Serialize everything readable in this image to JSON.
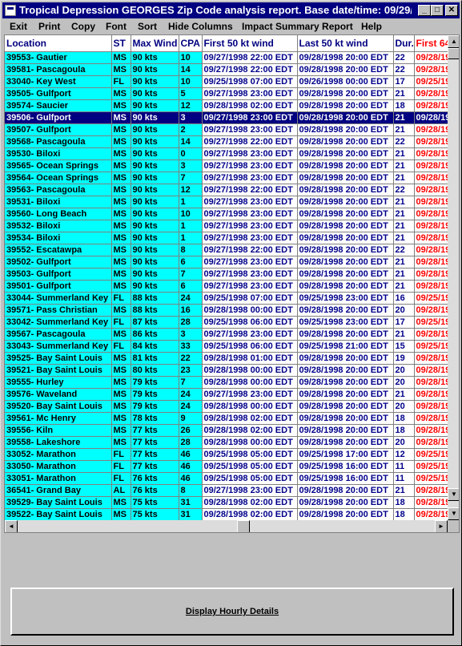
{
  "window": {
    "title": "Tropical Depression GEORGES Zip Code  analysis report.  Base date/time: 09/29/19...",
    "minimize": "_",
    "maximize": "□",
    "close": "✕"
  },
  "menu": [
    "Exit",
    "Print",
    "Copy",
    "Font",
    "Sort",
    "Hide Columns",
    "Impact Summary Report",
    "Help"
  ],
  "columns": [
    "Location",
    "ST",
    "Max Wind",
    "CPA",
    "First 50 kt wind",
    "Last 50 kt wind",
    "Dur.",
    "First 64"
  ],
  "rows": [
    [
      "39553- Gautier",
      "MS",
      "90 kts",
      "10",
      "09/27/1998 22:00 EDT",
      "09/28/1998 20:00 EDT",
      "22",
      "09/28/19"
    ],
    [
      "39581- Pascagoula",
      "MS",
      "90 kts",
      "14",
      "09/27/1998 22:00 EDT",
      "09/28/1998 20:00 EDT",
      "22",
      "09/28/19"
    ],
    [
      "33040- Key West",
      "FL",
      "90 kts",
      "10",
      "09/25/1998 07:00 EDT",
      "09/26/1998 00:00 EDT",
      "17",
      "09/25/19"
    ],
    [
      "39505- Gulfport",
      "MS",
      "90 kts",
      "5",
      "09/27/1998 23:00 EDT",
      "09/28/1998 20:00 EDT",
      "21",
      "09/28/19"
    ],
    [
      "39574- Saucier",
      "MS",
      "90 kts",
      "12",
      "09/28/1998 02:00 EDT",
      "09/28/1998 20:00 EDT",
      "18",
      "09/28/19"
    ],
    [
      "39506- Gulfport",
      "MS",
      "90 kts",
      "3",
      "09/27/1998 23:00 EDT",
      "09/28/1998 20:00 EDT",
      "21",
      "09/28/19"
    ],
    [
      "39507- Gulfport",
      "MS",
      "90 kts",
      "2",
      "09/27/1998 23:00 EDT",
      "09/28/1998 20:00 EDT",
      "21",
      "09/28/19"
    ],
    [
      "39568- Pascagoula",
      "MS",
      "90 kts",
      "14",
      "09/27/1998 22:00 EDT",
      "09/28/1998 20:00 EDT",
      "22",
      "09/28/19"
    ],
    [
      "39530- Biloxi",
      "MS",
      "90 kts",
      "0",
      "09/27/1998 23:00 EDT",
      "09/28/1998 20:00 EDT",
      "21",
      "09/28/19"
    ],
    [
      "39565- Ocean Springs",
      "MS",
      "90 kts",
      "3",
      "09/27/1998 23:00 EDT",
      "09/28/1998 20:00 EDT",
      "21",
      "09/28/19"
    ],
    [
      "39564- Ocean Springs",
      "MS",
      "90 kts",
      "7",
      "09/27/1998 23:00 EDT",
      "09/28/1998 20:00 EDT",
      "21",
      "09/28/19"
    ],
    [
      "39563- Pascagoula",
      "MS",
      "90 kts",
      "12",
      "09/27/1998 22:00 EDT",
      "09/28/1998 20:00 EDT",
      "22",
      "09/28/19"
    ],
    [
      "39531- Biloxi",
      "MS",
      "90 kts",
      "1",
      "09/27/1998 23:00 EDT",
      "09/28/1998 20:00 EDT",
      "21",
      "09/28/19"
    ],
    [
      "39560- Long Beach",
      "MS",
      "90 kts",
      "10",
      "09/27/1998 23:00 EDT",
      "09/28/1998 20:00 EDT",
      "21",
      "09/28/19"
    ],
    [
      "39532- Biloxi",
      "MS",
      "90 kts",
      "1",
      "09/27/1998 23:00 EDT",
      "09/28/1998 20:00 EDT",
      "21",
      "09/28/19"
    ],
    [
      "39534- Biloxi",
      "MS",
      "90 kts",
      "1",
      "09/27/1998 23:00 EDT",
      "09/28/1998 20:00 EDT",
      "21",
      "09/28/19"
    ],
    [
      "39552- Escatawpa",
      "MS",
      "90 kts",
      "8",
      "09/27/1998 22:00 EDT",
      "09/28/1998 20:00 EDT",
      "22",
      "09/28/19"
    ],
    [
      "39502- Gulfport",
      "MS",
      "90 kts",
      "6",
      "09/27/1998 23:00 EDT",
      "09/28/1998 20:00 EDT",
      "21",
      "09/28/19"
    ],
    [
      "39503- Gulfport",
      "MS",
      "90 kts",
      "7",
      "09/27/1998 23:00 EDT",
      "09/28/1998 20:00 EDT",
      "21",
      "09/28/19"
    ],
    [
      "39501- Gulfport",
      "MS",
      "90 kts",
      "6",
      "09/27/1998 23:00 EDT",
      "09/28/1998 20:00 EDT",
      "21",
      "09/28/19"
    ],
    [
      "33044- Summerland Key",
      "FL",
      "88 kts",
      "24",
      "09/25/1998 07:00 EDT",
      "09/25/1998 23:00 EDT",
      "16",
      "09/25/19"
    ],
    [
      "39571- Pass Christian",
      "MS",
      "88 kts",
      "16",
      "09/28/1998 00:00 EDT",
      "09/28/1998 20:00 EDT",
      "20",
      "09/28/19"
    ],
    [
      "33042- Summerland Key",
      "FL",
      "87 kts",
      "28",
      "09/25/1998 06:00 EDT",
      "09/25/1998 23:00 EDT",
      "17",
      "09/25/19"
    ],
    [
      "39567- Pascagoula",
      "MS",
      "86 kts",
      "3",
      "09/27/1998 23:00 EDT",
      "09/28/1998 20:00 EDT",
      "21",
      "09/28/19"
    ],
    [
      "33043- Summerland Key",
      "FL",
      "84 kts",
      "33",
      "09/25/1998 06:00 EDT",
      "09/25/1998 21:00 EDT",
      "15",
      "09/25/19"
    ],
    [
      "39525- Bay Saint Louis",
      "MS",
      "81 kts",
      "22",
      "09/28/1998 01:00 EDT",
      "09/28/1998 20:00 EDT",
      "19",
      "09/28/19"
    ],
    [
      "39521- Bay Saint Louis",
      "MS",
      "80 kts",
      "23",
      "09/28/1998 00:00 EDT",
      "09/28/1998 20:00 EDT",
      "20",
      "09/28/19"
    ],
    [
      "39555- Hurley",
      "MS",
      "79 kts",
      "7",
      "09/28/1998 00:00 EDT",
      "09/28/1998 20:00 EDT",
      "20",
      "09/28/19"
    ],
    [
      "39576- Waveland",
      "MS",
      "79 kts",
      "24",
      "09/27/1998 23:00 EDT",
      "09/28/1998 20:00 EDT",
      "21",
      "09/28/19"
    ],
    [
      "39520- Bay Saint Louis",
      "MS",
      "79 kts",
      "24",
      "09/28/1998 00:00 EDT",
      "09/28/1998 20:00 EDT",
      "20",
      "09/28/19"
    ],
    [
      "39561- Mc Henry",
      "MS",
      "78 kts",
      "9",
      "09/28/1998 02:00 EDT",
      "09/28/1998 20:00 EDT",
      "18",
      "09/28/19"
    ],
    [
      "39556- Kiln",
      "MS",
      "77 kts",
      "26",
      "09/28/1998 02:00 EDT",
      "09/28/1998 20:00 EDT",
      "18",
      "09/28/19"
    ],
    [
      "39558- Lakeshore",
      "MS",
      "77 kts",
      "28",
      "09/28/1998 00:00 EDT",
      "09/28/1998 20:00 EDT",
      "20",
      "09/28/19"
    ],
    [
      "33052- Marathon",
      "FL",
      "77 kts",
      "46",
      "09/25/1998 05:00 EDT",
      "09/25/1998 17:00 EDT",
      "12",
      "09/25/19"
    ],
    [
      "33050- Marathon",
      "FL",
      "77 kts",
      "46",
      "09/25/1998 05:00 EDT",
      "09/25/1998 16:00 EDT",
      "11",
      "09/25/19"
    ],
    [
      "33051- Marathon",
      "FL",
      "76 kts",
      "46",
      "09/25/1998 05:00 EDT",
      "09/25/1998 16:00 EDT",
      "11",
      "09/25/19"
    ],
    [
      "36541- Grand Bay",
      "AL",
      "76 kts",
      "8",
      "09/27/1998 23:00 EDT",
      "09/28/1998 20:00 EDT",
      "21",
      "09/28/19"
    ],
    [
      "39529- Bay Saint Louis",
      "MS",
      "75 kts",
      "31",
      "09/28/1998 02:00 EDT",
      "09/28/1998 20:00 EDT",
      "18",
      "09/28/19"
    ],
    [
      "39522- Bay Saint Louis",
      "MS",
      "75 kts",
      "31",
      "09/28/1998 02:00 EDT",
      "09/28/1998 20:00 EDT",
      "18",
      "09/28/19"
    ]
  ],
  "selected_row": 5,
  "scroll": {
    "up": "▲",
    "down": "▼",
    "left": "◄",
    "right": "►"
  },
  "button": {
    "label": "Display Hourly Details"
  }
}
